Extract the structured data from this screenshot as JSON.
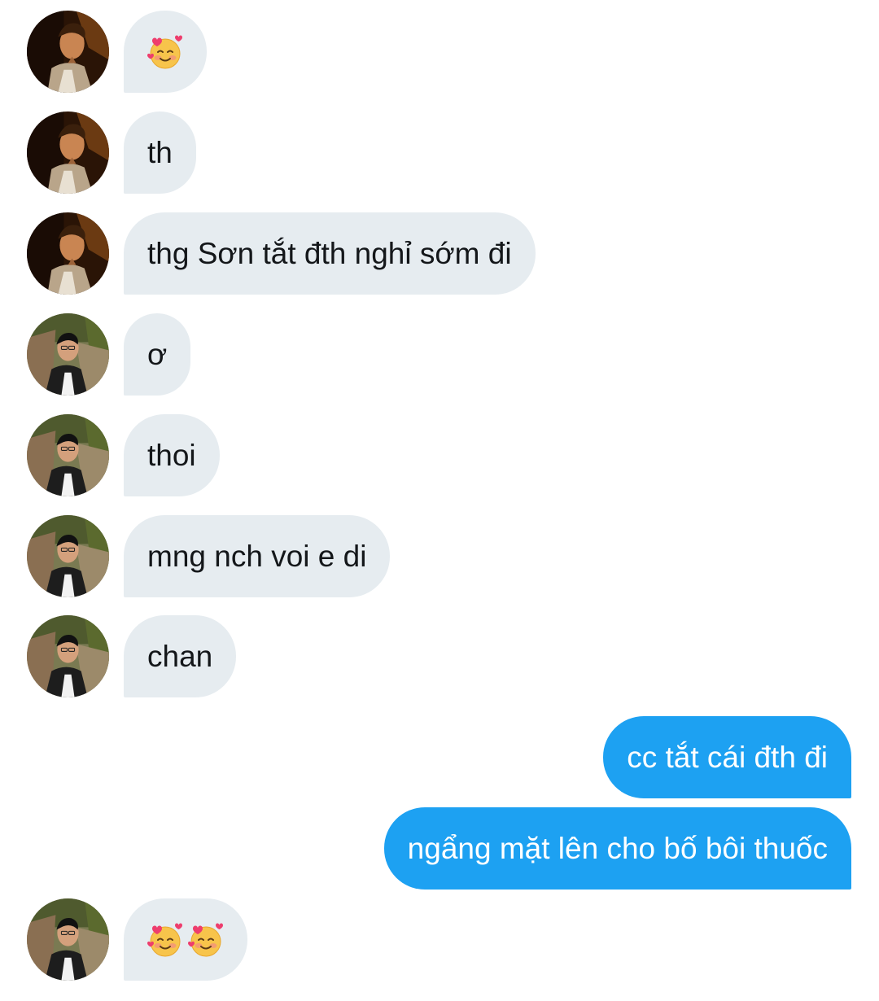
{
  "conversation": {
    "messages": [
      {
        "sender": "A",
        "direction": "incoming",
        "type": "emoji",
        "emoji": [
          "smiling-face-with-hearts-emoji"
        ]
      },
      {
        "sender": "A",
        "direction": "incoming",
        "type": "text",
        "text": "th"
      },
      {
        "sender": "A",
        "direction": "incoming",
        "type": "text",
        "text": "thg Sơn tắt đth nghỉ sớm đi"
      },
      {
        "sender": "B",
        "direction": "incoming",
        "type": "text",
        "text": "ơ"
      },
      {
        "sender": "B",
        "direction": "incoming",
        "type": "text",
        "text": "thoi"
      },
      {
        "sender": "B",
        "direction": "incoming",
        "type": "text",
        "text": "mng nch voi e di"
      },
      {
        "sender": "B",
        "direction": "incoming",
        "type": "text",
        "text": "chan"
      },
      {
        "sender": "me",
        "direction": "outgoing",
        "type": "text",
        "text": "cc tắt cái đth đi"
      },
      {
        "sender": "me",
        "direction": "outgoing",
        "type": "text",
        "text": "ngẩng mặt lên cho bố bôi thuốc"
      },
      {
        "sender": "B",
        "direction": "incoming",
        "type": "emoji",
        "emoji": [
          "smiling-face-with-hearts-emoji",
          "smiling-face-with-hearts-emoji"
        ]
      }
    ]
  },
  "colors": {
    "incoming_bubble": "#e6ecf0",
    "outgoing_bubble": "#1da1f2",
    "incoming_text": "#14171a",
    "outgoing_text": "#ffffff"
  }
}
